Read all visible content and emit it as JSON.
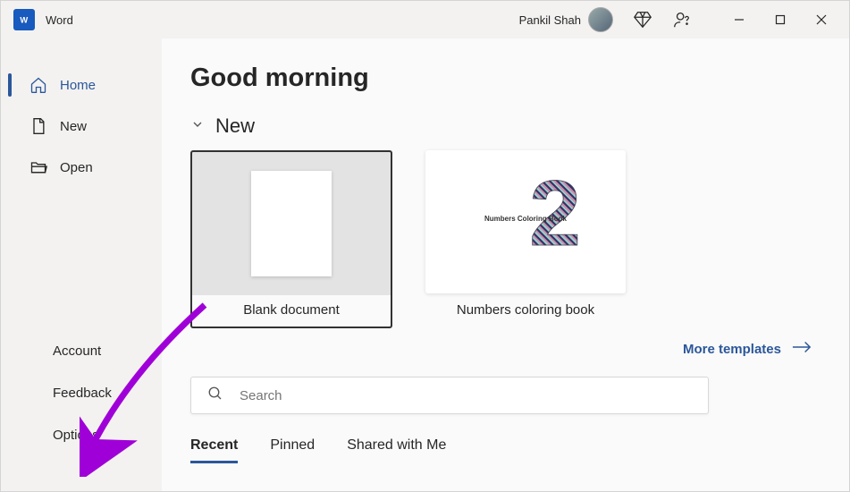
{
  "titlebar": {
    "app_name": "Word",
    "user_name": "Pankil Shah"
  },
  "sidebar": {
    "top": [
      {
        "label": "Home",
        "icon": "home"
      },
      {
        "label": "New",
        "icon": "page"
      },
      {
        "label": "Open",
        "icon": "folder"
      }
    ],
    "bottom": [
      {
        "label": "Account"
      },
      {
        "label": "Feedback"
      },
      {
        "label": "Options"
      }
    ]
  },
  "main": {
    "greeting": "Good morning",
    "section_new": "New",
    "templates": [
      {
        "label": "Blank document"
      },
      {
        "label": "Numbers coloring book",
        "thumb_text": "Numbers Coloring Book"
      }
    ],
    "more_templates": "More templates",
    "search_placeholder": "Search",
    "tabs": [
      {
        "label": "Recent"
      },
      {
        "label": "Pinned"
      },
      {
        "label": "Shared with Me"
      }
    ]
  }
}
